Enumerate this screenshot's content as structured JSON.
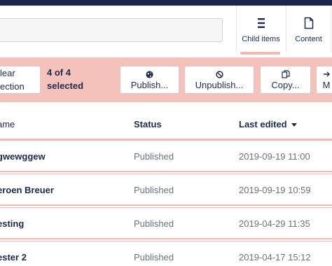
{
  "header": {
    "tabs": [
      {
        "label": "Child items",
        "icon": "list-icon"
      },
      {
        "label": "Content",
        "icon": "document-icon"
      }
    ]
  },
  "action_bar": {
    "clear_selection_label_1": "lear",
    "clear_selection_label_2": "ection",
    "selected_count_line1": "4 of 4",
    "selected_count_line2": "selected",
    "buttons": [
      {
        "label": "Publish...",
        "icon": "globe-icon"
      },
      {
        "label": "Unpublish...",
        "icon": "block-icon"
      },
      {
        "label": "Copy...",
        "icon": "copy-icon"
      },
      {
        "label": "M",
        "icon": "move-icon"
      }
    ]
  },
  "table": {
    "columns": {
      "name": "ame",
      "status": "Status",
      "last_edited": "Last edited"
    },
    "rows": [
      {
        "name": "gwewggew",
        "status": "Published",
        "last_edited": "2019-09-19 11:00"
      },
      {
        "name": "eroen Breuer",
        "status": "Published",
        "last_edited": "2019-09-19 10:59"
      },
      {
        "name": "esting",
        "status": "Published",
        "last_edited": "2019-04-29 11:35"
      },
      {
        "name": "ester 2",
        "status": "Published",
        "last_edited": "2019-04-17 15:12"
      }
    ]
  },
  "colors": {
    "top_bar": "#1b264f",
    "selection_bar": "#f5c1bb",
    "row_border": "#f3b8b2",
    "text": "#1b2a4e",
    "muted_text": "#6b7182"
  }
}
